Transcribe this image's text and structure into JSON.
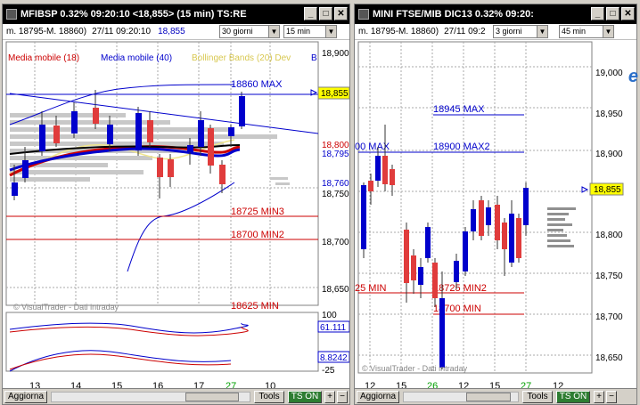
{
  "left": {
    "title": "MFIBSP 0.32% 09:20:10  <18,855>  (15 min) TS:RE",
    "info_range": "m. 18795-M. 18860)",
    "info_time": "27/11 09:20:10",
    "info_last": "18,855",
    "period_select": "30 giorni",
    "interval_select": "15 min",
    "legend": [
      {
        "label": "Media mobile (18)",
        "color": "#cc0000"
      },
      {
        "label": "Media mobile (40)",
        "color": "#0000cc"
      },
      {
        "label": "Bollinger Bands (20) Dev",
        "color": "#e8e070"
      },
      {
        "label": "B",
        "color": "#0000cc"
      }
    ],
    "price_labels": [
      "18,900",
      "18,850",
      "18,800",
      "18,795",
      "18,760",
      "18,750",
      "18,700",
      "18,650"
    ],
    "current_price": "18,855",
    "level_labels": [
      "18860 MAX",
      "18725 MIN3",
      "18700 MIN2",
      "18625 MIN"
    ],
    "watermark": "© VisualTrader - Dati intraday",
    "osc_labels": [
      "100",
      "61.111",
      "8.8242",
      "-25"
    ],
    "date_labels": [
      "13",
      "14",
      "15",
      "16",
      "17",
      "27",
      "10"
    ],
    "buttons": {
      "aggiorna": "Aggiorna",
      "tools": "Tools",
      "tson": "TS ON",
      "plus": "+",
      "minus": "−"
    },
    "colors": {
      "up": "#0000cc",
      "down": "#e03c3c",
      "ma18": "#cc0000",
      "ma40": "#0000cc",
      "bollinger": "#f0e68c",
      "current_price_bg": "#ffff00"
    }
  },
  "right": {
    "title": "MINI FTSE/MIB DIC13 0.32% 09:20:",
    "info_range": "m. 18795-M. 18860)",
    "info_time": "27/11 09:2",
    "period_select": "3 giorni",
    "interval_select": "45 min",
    "price_labels": [
      "19,000",
      "18,950",
      "18,900",
      "18,850",
      "18,800",
      "18,750",
      "18,700",
      "18,650"
    ],
    "current_price": "18,855",
    "level_labels": [
      "18945 MAX",
      "00 MAX",
      "18900 MAX2",
      "25 MIN",
      "18725 MIN2",
      "18700 MIN"
    ],
    "watermark": "© VisualTrader - Dati intraday",
    "date_labels": [
      "12",
      "15",
      "26",
      "12",
      "15",
      "26",
      "27",
      "12"
    ],
    "buttons": {
      "aggiorna": "Aggiorna",
      "tools": "Tools",
      "tson": "TS ON",
      "plus": "+",
      "minus": "−"
    }
  },
  "window_buttons": {
    "minimize": "_",
    "maximize": "□",
    "close": "✕"
  }
}
